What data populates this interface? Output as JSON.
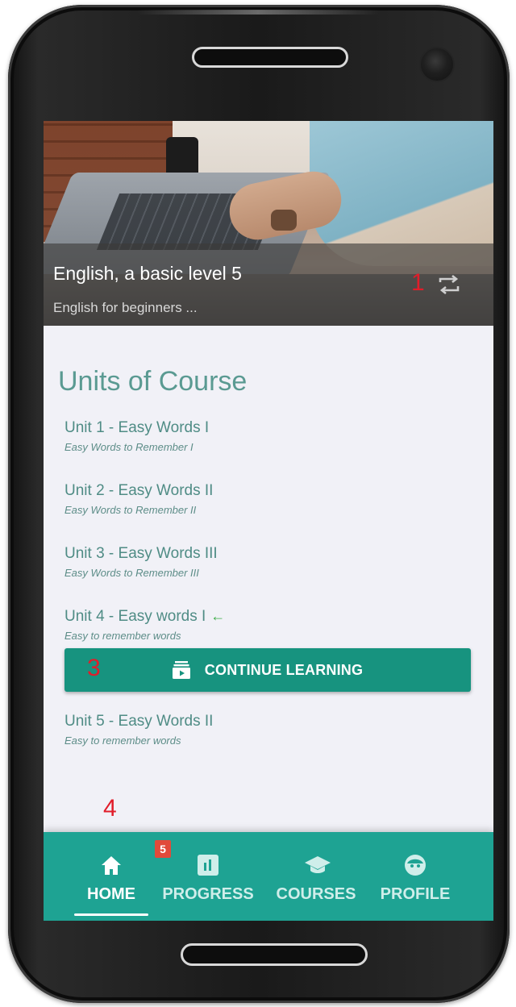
{
  "hero": {
    "title": "English, a basic level 5",
    "subtitle": "English for beginners ...",
    "marker": "1",
    "action_icon": "repeat-icon"
  },
  "units": {
    "title": "Units of Course",
    "items": [
      {
        "title": "Unit 1 - Easy Words I",
        "subtitle": "Easy Words to Remember I"
      },
      {
        "title": "Unit 2 - Easy Words II",
        "subtitle": "Easy Words to Remember II"
      },
      {
        "title": "Unit 3 - Easy Words III",
        "subtitle": "Easy Words to Remember III"
      },
      {
        "title": "Unit 4 - Easy words I",
        "subtitle": "Easy to remember words",
        "current": true
      },
      {
        "title": "Unit 5 - Easy Words II",
        "subtitle": "Easy to remember words"
      }
    ]
  },
  "continue": {
    "label": "CONTINUE LEARNING",
    "marker": "3",
    "icon": "lesson-stack-icon"
  },
  "markers": {
    "nav": "4"
  },
  "nav": {
    "items": [
      {
        "label": "HOME",
        "icon": "home-icon",
        "badge": "5",
        "active": true
      },
      {
        "label": "PROGRESS",
        "icon": "bar-chart-icon"
      },
      {
        "label": "COURSES",
        "icon": "graduation-cap-icon"
      },
      {
        "label": "PROFILE",
        "icon": "face-icon"
      }
    ]
  },
  "colors": {
    "accent": "#1ea393",
    "button": "#17937f",
    "text_teal": "#4f8c85",
    "marker_red": "#e11d2a",
    "current_arrow": "#3fae4a",
    "badge": "#e14a3a"
  }
}
